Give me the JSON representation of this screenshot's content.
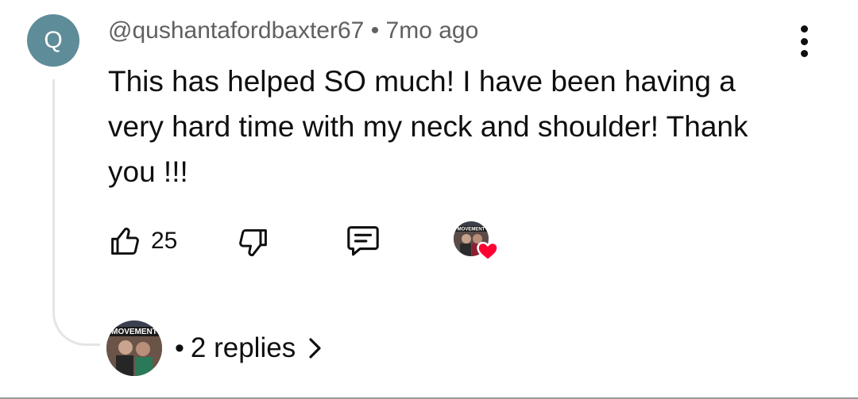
{
  "comment": {
    "avatar_letter": "Q",
    "avatar_color": "#5f8c99",
    "author": "@qushantafordbaxter67",
    "separator": "•",
    "timestamp": "7mo ago",
    "text": "This has helped SO much! I have been having a very hard time with my neck and shoulder! Thank you !!!"
  },
  "actions": {
    "like_icon": "thumb-up-icon",
    "like_count": "25",
    "dislike_icon": "thumb-down-icon",
    "reply_icon": "comment-icon",
    "hearted_by_creator": true,
    "heart_color": "#ff0033"
  },
  "replies": {
    "separator": "•",
    "label": "2 replies",
    "chevron_icon": "chevron-right-icon",
    "creator_avatar_text": "MOVEMENT"
  }
}
